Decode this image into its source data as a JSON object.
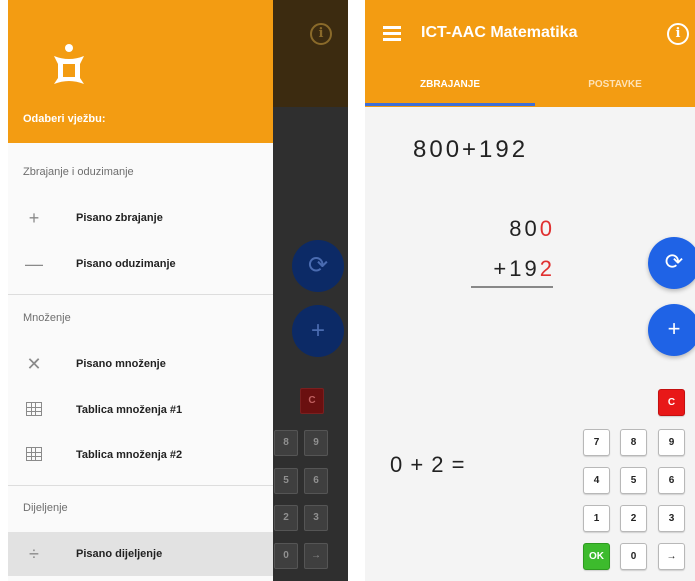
{
  "colors": {
    "accent": "#f39c12",
    "fab": "#1f63e6",
    "tab_indicator": "#3f6fd6",
    "highlight_digit": "#e03030",
    "clear_key": "#e81818",
    "ok_key": "#3dbb2d"
  },
  "drawer": {
    "header_title": "Odaberi vježbu:",
    "sections": [
      {
        "title": "Zbrajanje i oduzimanje",
        "items": [
          {
            "icon": "plus-icon",
            "label": "Pisano zbrajanje"
          },
          {
            "icon": "minus-icon",
            "label": "Pisano oduzimanje"
          }
        ]
      },
      {
        "title": "Množenje",
        "items": [
          {
            "icon": "multiply-icon",
            "label": "Pisano množenje"
          },
          {
            "icon": "grid-icon",
            "label": "Tablica množenja #1"
          },
          {
            "icon": "grid-icon",
            "label": "Tablica množenja #2"
          }
        ]
      },
      {
        "title": "Dijeljenje",
        "items": [
          {
            "icon": "divide-icon",
            "label": "Pisano dijeljenje",
            "selected": true
          }
        ]
      }
    ]
  },
  "background_app": {
    "keys": [
      "C",
      "8",
      "9",
      "5",
      "6",
      "2",
      "3",
      "0",
      "→"
    ]
  },
  "app": {
    "title": "ICT-AAC Matematika",
    "tabs": [
      {
        "label": "ZBRAJANJE",
        "active": true
      },
      {
        "label": "POSTAVKE",
        "active": false
      }
    ],
    "expression": "800+192",
    "addend1": {
      "plain": "80",
      "highlight": "0"
    },
    "addend2": {
      "plain": "+19",
      "highlight": "2"
    },
    "equation": "0 + 2 =",
    "fab_refresh_icon": "refresh-icon",
    "fab_add_icon": "plus-icon",
    "keypad": {
      "clear": "C",
      "rows": [
        [
          "7",
          "8",
          "9"
        ],
        [
          "4",
          "5",
          "6"
        ],
        [
          "1",
          "2",
          "3"
        ]
      ],
      "ok": "OK",
      "zero": "0",
      "enter": "→"
    }
  }
}
